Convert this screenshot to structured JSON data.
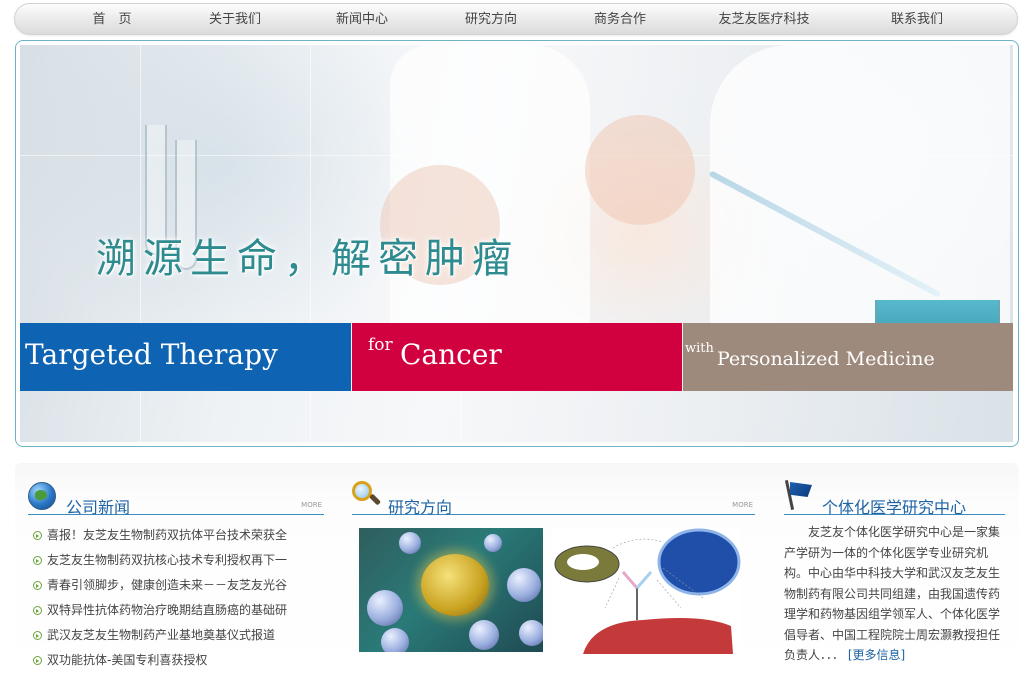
{
  "nav": {
    "items": [
      "首　页",
      "关于我们",
      "新闻中心",
      "研究方向",
      "商务合作",
      "友芝友医疗科技",
      "联系我们"
    ]
  },
  "banner": {
    "slogan": "溯源生命，解密肿瘤",
    "band1": "Targeted Therapy",
    "band2_small": "for",
    "band2_big": "Cancer",
    "band3_small": "with",
    "band3_big": "Personalized Medicine"
  },
  "news": {
    "title": "公司新闻",
    "more": "MORE",
    "items": [
      "喜报！友芝友生物制药双抗体平台技术荣获全",
      "友芝友生物制药双抗核心技术专利授权再下一",
      "青春引领脚步，健康创造未来－－友芝友光谷",
      "双特异性抗体药物治疗晚期结直肠癌的基础研",
      "武汉友芝友生物制药产业基地奠基仪式报道",
      "双功能抗体-美国专利喜获授权"
    ]
  },
  "research": {
    "title": "研究方向",
    "more": "MORE"
  },
  "center": {
    "title": "个体化医学研究中心",
    "text": "友芝友个体化医学研究中心是一家集产学研为一体的个体化医学专业研究机构。中心由华中科技大学和武汉友芝友生物制药有限公司共同组建，由我国遗传药理学和药物基因组学领军人、个体化医学倡导者、中国工程院院士周宏灏教授担任负责人．．．",
    "more_link": "[更多信息]"
  },
  "colors": {
    "band_blue": "#0f63b3",
    "band_red": "#d1003f",
    "band_taupe": "#9e8a7d",
    "section_blue": "#1e63a5",
    "slogan_teal": "#2e8b8f"
  },
  "icons": [
    "globe-icon",
    "magnifier-icon",
    "flag-icon",
    "bullet-arrow-icon"
  ]
}
